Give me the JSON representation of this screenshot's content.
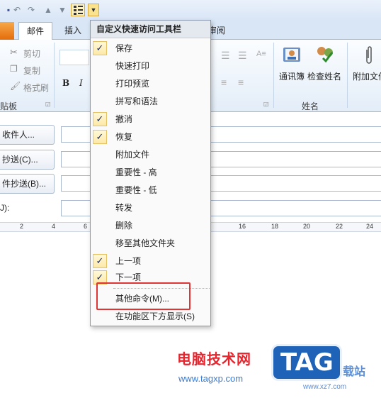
{
  "tabs": {
    "mail": "邮件",
    "insert": "插入",
    "review_partial": "审阅"
  },
  "clipboard": {
    "cut": "剪切",
    "copy": "复制",
    "format_painter": "格式刷",
    "group": "贴板"
  },
  "names": {
    "address_book": "通讯簿",
    "check_names": "检查姓名",
    "group": "姓名",
    "attach": "附加文件"
  },
  "format": {
    "bold": "B",
    "italic": "I"
  },
  "form": {
    "to": "收件人...",
    "cc": "抄送(C)...",
    "bcc": "件抄送(B)...",
    "subject": "J):"
  },
  "ruler": [
    "2",
    "4",
    "6",
    "16",
    "18",
    "20",
    "22",
    "24"
  ],
  "menu": {
    "title": "自定义快速访问工具栏",
    "items": [
      {
        "label": "保存",
        "checked": true
      },
      {
        "label": "快速打印",
        "checked": false
      },
      {
        "label": "打印预览",
        "checked": false
      },
      {
        "label": "拼写和语法",
        "checked": false
      },
      {
        "label": "撤消",
        "checked": true
      },
      {
        "label": "恢复",
        "checked": true
      },
      {
        "label": "附加文件",
        "checked": false
      },
      {
        "label": "重要性 - 高",
        "checked": false
      },
      {
        "label": "重要性 - 低",
        "checked": false
      },
      {
        "label": "转发",
        "checked": false
      },
      {
        "label": "删除",
        "checked": false
      },
      {
        "label": "移至其他文件夹",
        "checked": false
      },
      {
        "label": "上一项",
        "checked": true
      },
      {
        "label": "下一项",
        "checked": true
      },
      {
        "label": "其他命令(M)...",
        "checked": false
      },
      {
        "label": "在功能区下方显示(S)",
        "checked": false
      }
    ]
  },
  "watermark": {
    "cn": "电脑技术网",
    "url": "www.tagxp.com",
    "tag": "TAG",
    "site": "载站",
    "url2": "www.xz7.com"
  },
  "colors": {
    "highlight": "#e03535",
    "check_bg": "#fde9a6",
    "ribbon": "#e3edf8"
  }
}
